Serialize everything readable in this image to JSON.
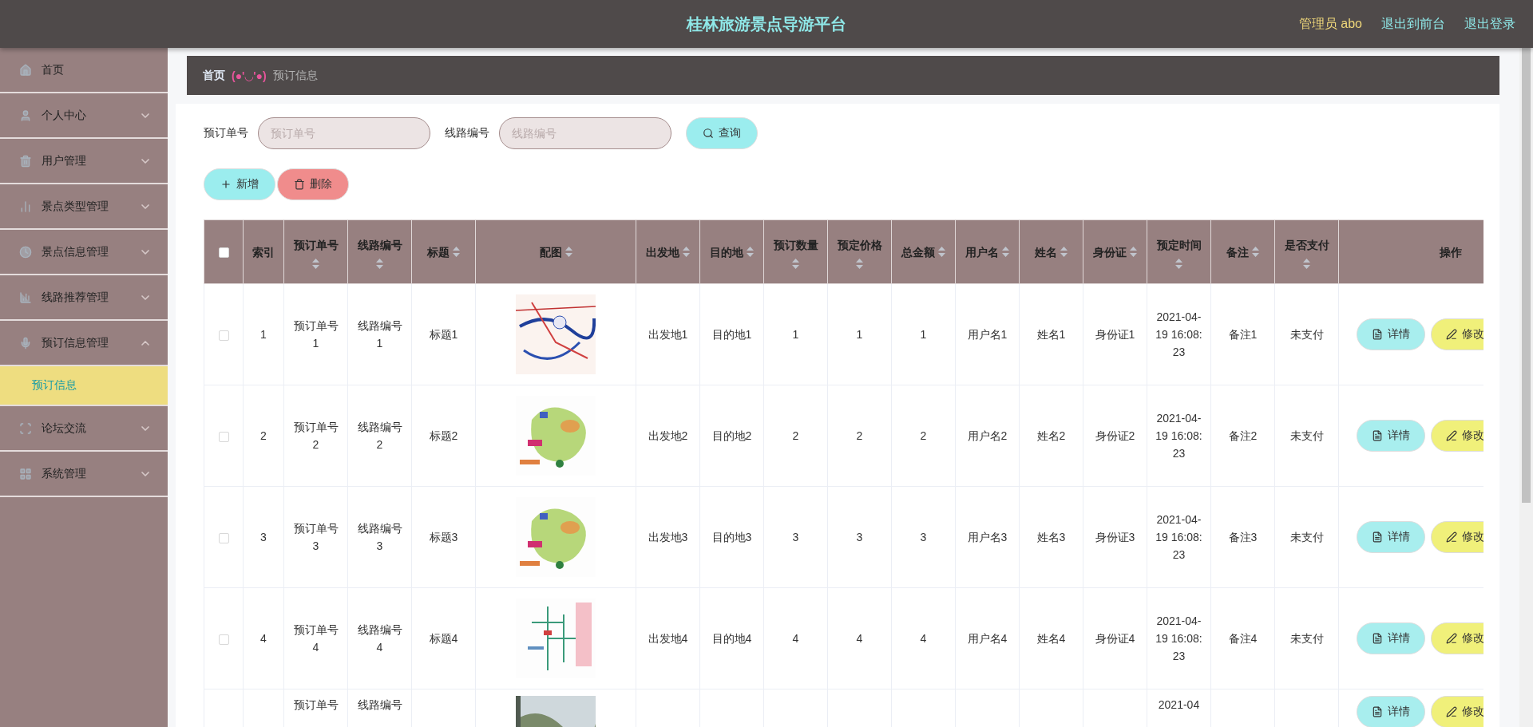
{
  "header": {
    "title": "桂林旅游景点导游平台",
    "user": "管理员 abo",
    "links": [
      "退出到前台",
      "退出登录"
    ]
  },
  "sidebar": {
    "items": [
      {
        "label": "首页"
      },
      {
        "label": "个人中心",
        "expanded": false
      },
      {
        "label": "用户管理",
        "expanded": false
      },
      {
        "label": "景点类型管理",
        "expanded": false
      },
      {
        "label": "景点信息管理",
        "expanded": false
      },
      {
        "label": "线路推荐管理",
        "expanded": false
      },
      {
        "label": "预订信息管理",
        "expanded": true,
        "children": [
          {
            "label": "预订信息",
            "selected": true
          }
        ]
      },
      {
        "label": "论坛交流",
        "expanded": false
      },
      {
        "label": "系统管理",
        "expanded": false
      }
    ]
  },
  "breadcrumb": {
    "home": "首页",
    "separator": "(●'◡'●)",
    "current": "预订信息"
  },
  "search": {
    "fields": [
      {
        "label": "预订单号",
        "placeholder": "预订单号"
      },
      {
        "label": "线路编号",
        "placeholder": "线路编号"
      }
    ],
    "button": "查询"
  },
  "actions": [
    {
      "kind": "add",
      "label": "新增"
    },
    {
      "kind": "delete",
      "label": "删除"
    }
  ],
  "table": {
    "select_all": {
      "checked": false
    },
    "columns": [
      {
        "label": "索引",
        "sortable": false
      },
      {
        "label": "预订单号",
        "sortable": true
      },
      {
        "label": "线路编号",
        "sortable": true
      },
      {
        "label": "标题",
        "sortable": true
      },
      {
        "label": "配图",
        "sortable": true
      },
      {
        "label": "出发地",
        "sortable": true
      },
      {
        "label": "目的地",
        "sortable": true
      },
      {
        "label": "预订数量",
        "sortable": true
      },
      {
        "label": "预定价格",
        "sortable": true
      },
      {
        "label": "总金额",
        "sortable": true
      },
      {
        "label": "用户名",
        "sortable": true
      },
      {
        "label": "姓名",
        "sortable": true
      },
      {
        "label": "身份证",
        "sortable": true
      },
      {
        "label": "预定时间",
        "sortable": true
      },
      {
        "label": "备注",
        "sortable": true
      },
      {
        "label": "是否支付",
        "sortable": true
      },
      {
        "label": "操作",
        "sortable": false
      }
    ],
    "rows": [
      {
        "checked": false,
        "index": "1",
        "order_no": "预订单号1",
        "route_no": "线路编号1",
        "title": "标题1",
        "departure": "出发地1",
        "destination": "目的地1",
        "quantity": "1",
        "price": "1",
        "total": "1",
        "username": "用户名1",
        "name": "姓名1",
        "id_card": "身份证1",
        "time": "2021-04-19 16:08:23",
        "remark": "备注1",
        "paid": "未支付",
        "buttons": [
          "详情",
          "修改"
        ]
      },
      {
        "checked": false,
        "index": "2",
        "order_no": "预订单号2",
        "route_no": "线路编号2",
        "title": "标题2",
        "departure": "出发地2",
        "destination": "目的地2",
        "quantity": "2",
        "price": "2",
        "total": "2",
        "username": "用户名2",
        "name": "姓名2",
        "id_card": "身份证2",
        "time": "2021-04-19 16:08:23",
        "remark": "备注2",
        "paid": "未支付",
        "buttons": [
          "详情",
          "修改"
        ]
      },
      {
        "checked": false,
        "index": "3",
        "order_no": "预订单号3",
        "route_no": "线路编号3",
        "title": "标题3",
        "departure": "出发地3",
        "destination": "目的地3",
        "quantity": "3",
        "price": "3",
        "total": "3",
        "username": "用户名3",
        "name": "姓名3",
        "id_card": "身份证3",
        "time": "2021-04-19 16:08:23",
        "remark": "备注3",
        "paid": "未支付",
        "buttons": [
          "详情",
          "修改"
        ]
      },
      {
        "checked": false,
        "index": "4",
        "order_no": "预订单号4",
        "route_no": "线路编号4",
        "title": "标题4",
        "departure": "出发地4",
        "destination": "目的地4",
        "quantity": "4",
        "price": "4",
        "total": "4",
        "username": "用户名4",
        "name": "姓名4",
        "id_card": "身份证4",
        "time": "2021-04-19 16:08:23",
        "remark": "备注4",
        "paid": "未支付",
        "buttons": [
          "详情",
          "修改"
        ]
      },
      {
        "order_no": "预订单号",
        "route_no": "线路编号",
        "time": "2021-04",
        "buttons": [
          "详情",
          "修改"
        ]
      }
    ]
  }
}
